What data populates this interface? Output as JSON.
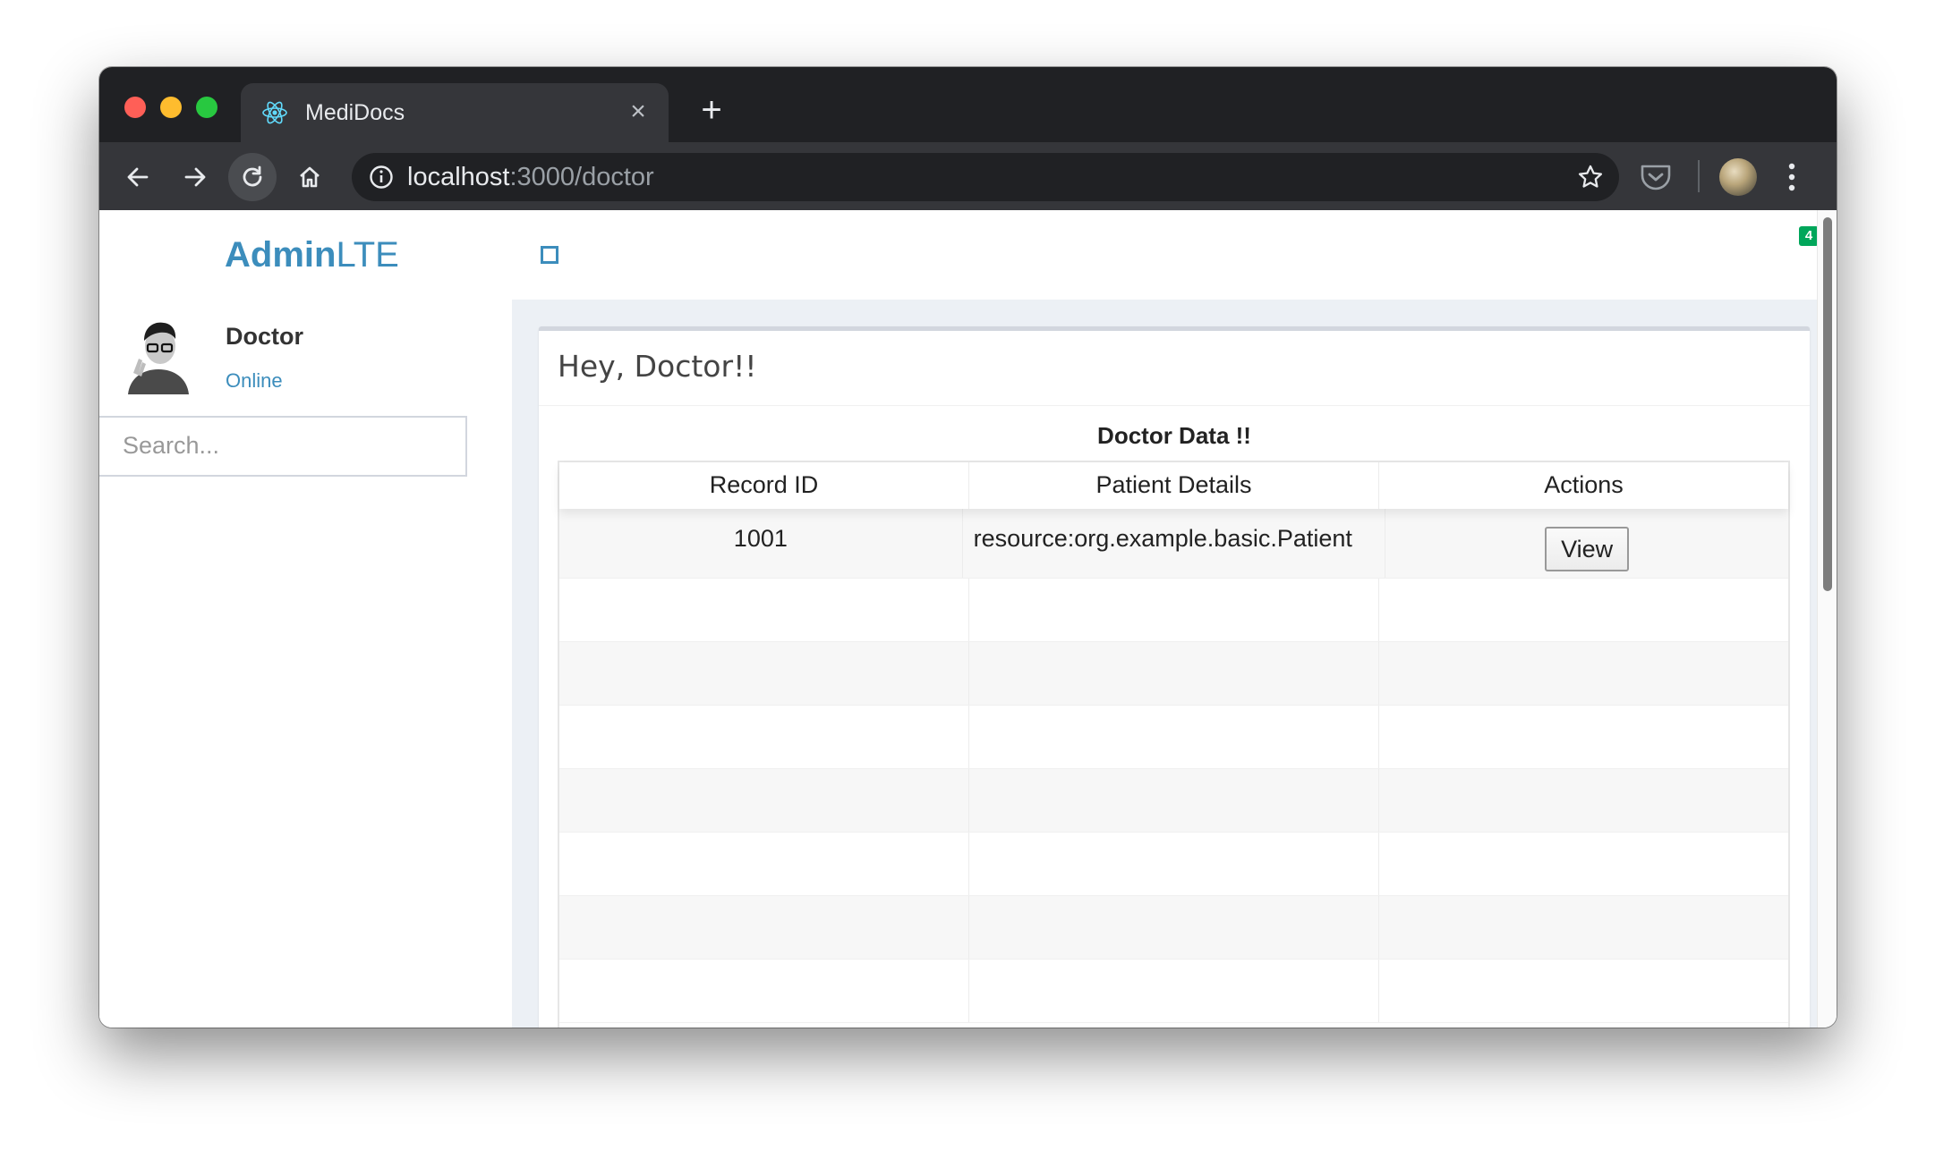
{
  "browser": {
    "tab_title": "MediDocs",
    "tab_close": "×",
    "new_tab": "+",
    "url_host": "localhost",
    "url_rest": ":3000/doctor"
  },
  "sidebar": {
    "logo_bold": "Admin",
    "logo_light": "LTE",
    "user_name": "Doctor",
    "user_status": "Online",
    "search_placeholder": "Search..."
  },
  "topbar": {
    "notification_count": "4"
  },
  "main": {
    "greeting": "Hey, Doctor!!",
    "table_caption": "Doctor Data !!",
    "columns": [
      "Record ID",
      "Patient Details",
      "Actions"
    ],
    "rows": [
      {
        "record_id": "1001",
        "patient_details": "resource:org.example.basic.Patient",
        "action_label": "View"
      }
    ]
  },
  "colors": {
    "accent": "#3c8dbc",
    "badge": "#00a65a",
    "content_bg": "#ecf0f5"
  }
}
